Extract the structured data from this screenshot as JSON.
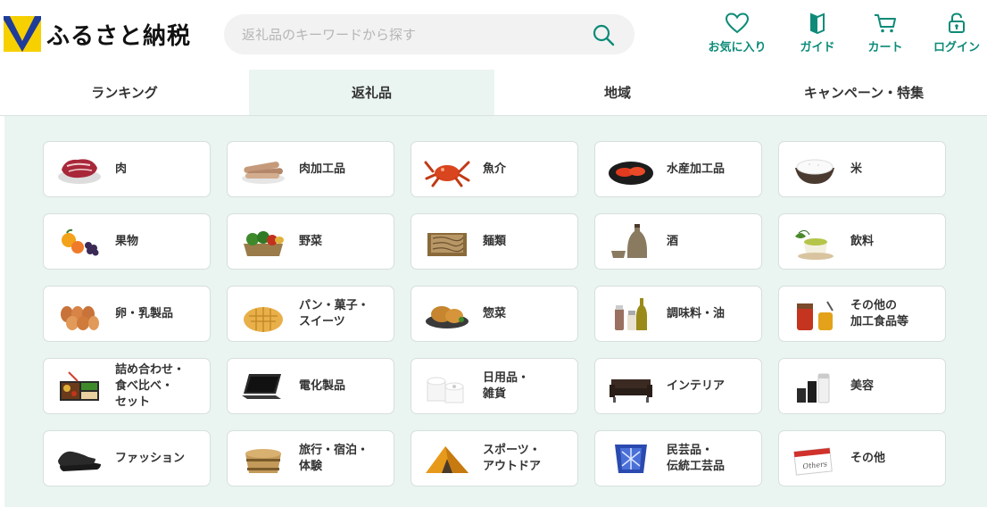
{
  "header": {
    "logo_text": "ふるさと納税",
    "search_placeholder": "返礼品のキーワードから探す",
    "icons": [
      {
        "label": "お気に入り",
        "icon": "heart-icon"
      },
      {
        "label": "ガイド",
        "icon": "guide-book-icon"
      },
      {
        "label": "カート",
        "icon": "cart-icon"
      },
      {
        "label": "ログイン",
        "icon": "login-lock-icon"
      }
    ]
  },
  "tabs": [
    {
      "label": "ランキング",
      "active": false
    },
    {
      "label": "返礼品",
      "active": true
    },
    {
      "label": "地域",
      "active": false
    },
    {
      "label": "キャンペーン・特集",
      "active": false
    }
  ],
  "categories": [
    {
      "label": "肉",
      "icon": "meat-icon"
    },
    {
      "label": "肉加工品",
      "icon": "sausage-icon"
    },
    {
      "label": "魚介",
      "icon": "crab-icon"
    },
    {
      "label": "水産加工品",
      "icon": "cod-roe-icon"
    },
    {
      "label": "米",
      "icon": "rice-bowl-icon"
    },
    {
      "label": "果物",
      "icon": "fruit-icon"
    },
    {
      "label": "野菜",
      "icon": "vegetable-basket-icon"
    },
    {
      "label": "麺類",
      "icon": "soba-icon"
    },
    {
      "label": "酒",
      "icon": "sake-bottle-icon"
    },
    {
      "label": "飲料",
      "icon": "green-tea-icon"
    },
    {
      "label": "卵・乳製品",
      "icon": "eggs-icon"
    },
    {
      "label": "パン・菓子・\nスイーツ",
      "icon": "melon-bread-icon"
    },
    {
      "label": "惣菜",
      "icon": "croquette-icon"
    },
    {
      "label": "調味料・油",
      "icon": "seasoning-bottles-icon"
    },
    {
      "label": "その他の\n加工食品等",
      "icon": "honey-jar-icon"
    },
    {
      "label": "詰め合わせ・\n食べ比べ・\nセット",
      "icon": "bento-box-icon"
    },
    {
      "label": "電化製品",
      "icon": "laptop-icon"
    },
    {
      "label": "日用品・\n雑貨",
      "icon": "toilet-paper-icon"
    },
    {
      "label": "インテリア",
      "icon": "sofa-icon"
    },
    {
      "label": "美容",
      "icon": "cosmetics-icon"
    },
    {
      "label": "ファッション",
      "icon": "leather-shoes-icon"
    },
    {
      "label": "旅行・宿泊・\n体験",
      "icon": "wooden-tub-icon"
    },
    {
      "label": "スポーツ・\nアウトドア",
      "icon": "tent-icon"
    },
    {
      "label": "民芸品・\n伝統工芸品",
      "icon": "kiriko-glass-icon"
    },
    {
      "label": "その他",
      "icon": "others-card-icon"
    }
  ],
  "colors": {
    "accent": "#0d8b78",
    "panel_bg": "#eaf5f1",
    "logo_yellow": "#f7d000",
    "logo_blue": "#1f3c9a"
  }
}
